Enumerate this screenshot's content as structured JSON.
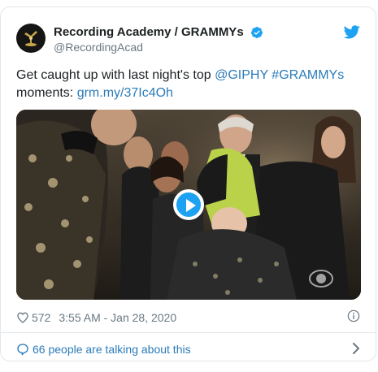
{
  "account": {
    "display_name": "Recording Academy / GRAMMYs",
    "handle": "@RecordingAcad",
    "verified_icon": "verified-badge-icon",
    "avatar_icon": "gramophone-logo"
  },
  "tweet": {
    "text_before": "Get caught up with last night's top ",
    "mention": "@GIPHY",
    "space": " ",
    "hashtag": "#GRAMMYs",
    "text_after": "moments: ",
    "link": "grm.my/37Ic4Oh"
  },
  "media": {
    "play_icon": "play-icon"
  },
  "meta": {
    "like_count": "572",
    "timestamp": "3:55 AM - Jan 28, 2020"
  },
  "footer": {
    "talking_label": "66 people are talking about this"
  },
  "colors": {
    "link": "#2b7bb9",
    "twitter_blue": "#1da1f2",
    "muted": "#697882",
    "border": "#e1e8ed"
  }
}
